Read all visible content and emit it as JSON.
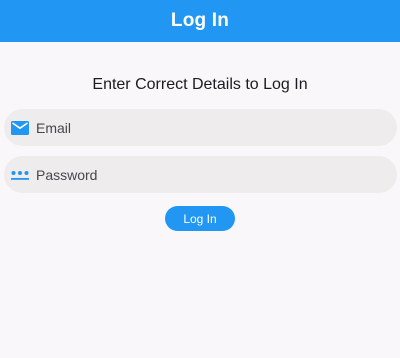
{
  "app_bar": {
    "title": "Log In"
  },
  "form": {
    "heading": "Enter Correct Details to Log In",
    "email": {
      "placeholder": "Email",
      "value": "",
      "icon": "mail-icon"
    },
    "password": {
      "placeholder": "Password",
      "value": "",
      "icon": "password-dots-icon"
    },
    "login_button_label": "Log In"
  },
  "colors": {
    "primary": "#2196f3",
    "background": "#f9f7f9",
    "field_fill": "#eeeced",
    "text": "#1c1b1f",
    "hint_text": "#49454f"
  }
}
